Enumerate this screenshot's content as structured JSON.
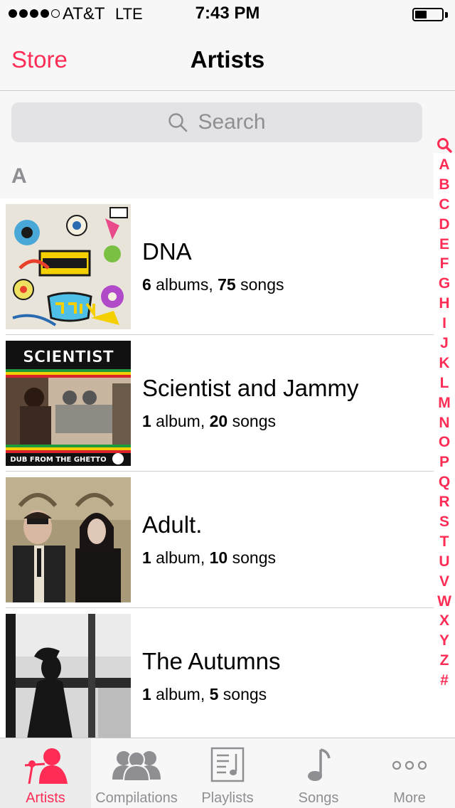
{
  "status_bar": {
    "carrier": "AT&T",
    "network": "LTE",
    "time": "7:43 PM",
    "signal_strength": 4,
    "signal_max": 5,
    "battery_level": 0.45
  },
  "nav": {
    "back_label": "Store",
    "title": "Artists"
  },
  "search": {
    "placeholder": "Search"
  },
  "section": {
    "letter": "A"
  },
  "artists": [
    {
      "name": "DNA",
      "albums_count": "6",
      "albums_word": " albums, ",
      "songs_count": "75",
      "songs_word": " songs",
      "art_icon": "dangerhouse-album-art"
    },
    {
      "name": "Scientist and Jammy",
      "albums_count": "1",
      "albums_word": " album, ",
      "songs_count": "20",
      "songs_word": " songs",
      "art_icon": "scientist-album-art",
      "art_text_top": "SCIENTIST",
      "art_text_bottom": "DUB FROM THE GHETTO"
    },
    {
      "name": "Adult.",
      "albums_count": "1",
      "albums_word": " album, ",
      "songs_count": "10",
      "songs_word": " songs",
      "art_icon": "adult-album-art"
    },
    {
      "name": "The Autumns",
      "albums_count": "1",
      "albums_word": " album, ",
      "songs_count": "5",
      "songs_word": " songs",
      "art_icon": "autumns-album-art"
    }
  ],
  "index": [
    "A",
    "B",
    "C",
    "D",
    "E",
    "F",
    "G",
    "H",
    "I",
    "J",
    "K",
    "L",
    "M",
    "N",
    "O",
    "P",
    "Q",
    "R",
    "S",
    "T",
    "U",
    "V",
    "W",
    "X",
    "Y",
    "Z",
    "#"
  ],
  "tabs": [
    {
      "label": "Artists",
      "icon": "artists-icon",
      "active": true
    },
    {
      "label": "Compilations",
      "icon": "compilations-icon",
      "active": false
    },
    {
      "label": "Playlists",
      "icon": "playlists-icon",
      "active": false
    },
    {
      "label": "Songs",
      "icon": "songs-icon",
      "active": false
    },
    {
      "label": "More",
      "icon": "more-icon",
      "active": false
    }
  ],
  "colors": {
    "accent": "#ff2d55",
    "secondary_text": "#8e8e93",
    "bar_background": "#f7f7f7"
  }
}
